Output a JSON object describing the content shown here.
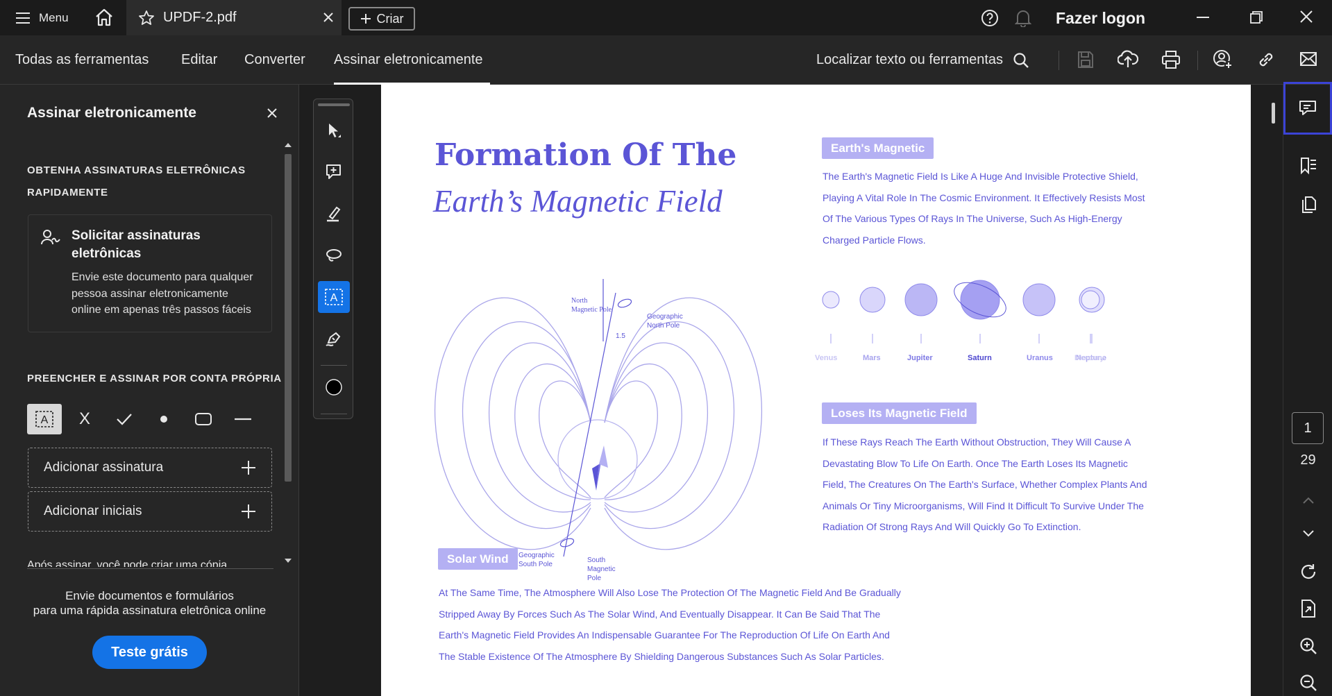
{
  "titlebar": {
    "menu_label": "Menu",
    "tab_title": "UPDF-2.pdf",
    "create_label": "Criar",
    "login_label": "Fazer logon"
  },
  "menubar": {
    "tabs": [
      "Todas as ferramentas",
      "Editar",
      "Converter",
      "Assinar eletronicamente"
    ],
    "search_label": "Localizar texto ou ferramentas"
  },
  "leftpanel": {
    "title": "Assinar eletronicamente",
    "section1_line1": "OBTENHA ASSINATURAS ELETRÔNICAS",
    "section1_line2": "RAPIDAMENTE",
    "card_title_line1": "Solicitar assinaturas",
    "card_title_line2": "eletrônicas",
    "card_desc_line1": "Envie este documento para qualquer",
    "card_desc_line2": "pessoa assinar eletronicamente",
    "card_desc_line3": "online em apenas três passos fáceis",
    "section2": "PREENCHER E ASSINAR POR CONTA PRÓPRIA",
    "tool_x": "X",
    "add_signature": "Adicionar assinatura",
    "add_initials": "Adicionar iniciais",
    "cut_text": "Após assinar, você pode criar uma cópia",
    "promo_line1": "Envie documentos e formulários",
    "promo_line2": "para uma rápida assinatura eletrônica online",
    "trial_button": "Teste grátis"
  },
  "document": {
    "title_line1": "Formation Of The",
    "title_line2": "Earth’s Magnetic Field",
    "diagram_labels": {
      "north_magnetic_1": "North",
      "north_magnetic_2": "Magnetic Pole",
      "geo_north_1": "Geographic",
      "geo_north_2": "North Pole",
      "angle": "1.5",
      "geo_south_1": "Geographic",
      "geo_south_2": "South Pole",
      "south_magnetic_1": "South",
      "south_magnetic_2": "Magnetic",
      "south_magnetic_3": "Pole"
    },
    "section1_heading": "Earth's Magnetic",
    "section1_lines": [
      "The Earth's Magnetic Field Is Like A Huge And Invisible Protective Shield,",
      "Playing A Vital Role In The Cosmic Environment. It Effectively Resists Most",
      "Of The Various Types Of Rays In The Universe, Such As High-Energy",
      "Charged Particle Flows."
    ],
    "planets": [
      "Venus",
      "Mars",
      "Jupiter",
      "Saturn",
      "Uranus",
      "Neptune",
      "Mercury"
    ],
    "section2_heading": "Loses Its Magnetic Field",
    "section2_lines": [
      "If These Rays Reach The Earth Without Obstruction, They Will Cause A",
      "Devastating Blow To Life On Earth. Once The Earth Loses Its Magnetic",
      "Field, The Creatures On The Earth's Surface, Whether Complex Plants And",
      "Animals Or Tiny Microorganisms, Will Find It Difficult To Survive Under The",
      "Radiation Of Strong Rays And Will Quickly Go To Extinction."
    ],
    "section3_heading": "Solar Wind",
    "section3_lines": [
      "At The Same Time, The Atmosphere Will Also Lose The Protection Of The Magnetic Field And Be Gradually",
      "Stripped Away By Forces Such As The Solar Wind, And Eventually Disappear. It Can Be Said That The",
      "Earth's Magnetic Field Provides An Indispensable Guarantee For The Reproduction Of Life On Earth And",
      "The Stable Existence Of The Atmosphere By Shielding Dangerous Substances Such As Solar Particles."
    ]
  },
  "pager": {
    "current_page": "1",
    "total_pages": "29"
  },
  "colors": {
    "accent_blue": "#1473e6",
    "doc_purple": "#5b55d6",
    "pill_bg": "#b4b0f3",
    "highlight_border": "#3b43d6"
  }
}
